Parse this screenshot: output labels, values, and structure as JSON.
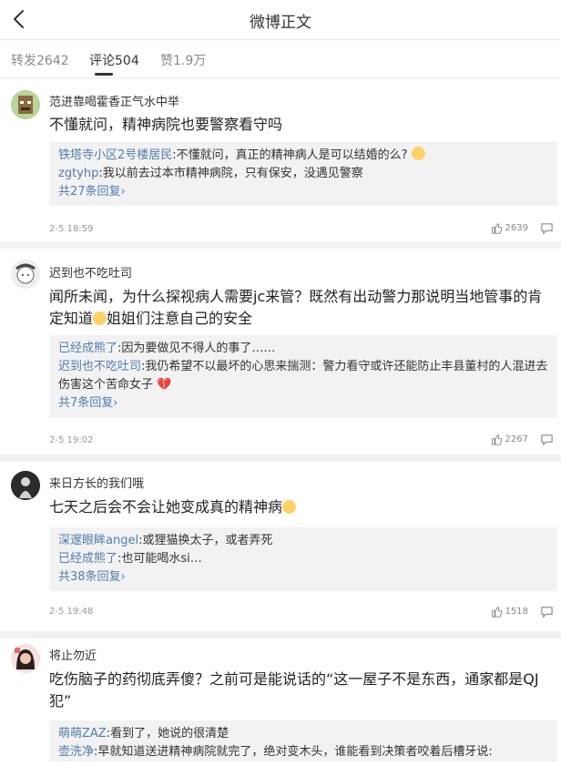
{
  "header": {
    "title": "微博正文"
  },
  "tabs": [
    {
      "label": "转发2642"
    },
    {
      "label": "评论504"
    },
    {
      "label": "赞1.9万"
    }
  ],
  "comments": [
    {
      "user": "范进靠喝霍香正气水中举",
      "text": "不懂就问，精神病院也要警察看守吗",
      "replies": [
        {
          "user": "铁塔寺小区2号楼居民",
          "text": ":不懂就问，真正的精神病人是可以结婚的么?"
        },
        {
          "user": "zgtyhp",
          "text": ":我以前去过本市精神病院，只有保安，没遇见警察"
        }
      ],
      "more": "共27条回复›",
      "time": "2-5 18:59",
      "likes": "2639"
    },
    {
      "user": "迟到也不吃吐司",
      "text_part1": "闻所未闻，为什么探视病人需要jc来管？既然有出动警力那说明当地管事的肯定知道",
      "text_part2": "姐姐们注意自己的安全",
      "replies": [
        {
          "user": "已经成熊了",
          "text": ":因为要做见不得人的事了……"
        },
        {
          "user": "迟到也不吃吐司",
          "text": ":我仍希望不以最坏的心思来揣测：警力看守或许还能防止丰县董村的人混进去伤害这个苦命女子"
        }
      ],
      "more": "共7条回复›",
      "time": "2-5 19:02",
      "likes": "2267"
    },
    {
      "user": "来日方长的我们哦",
      "text": "七天之后会不会让她变成真的精神病",
      "replies": [
        {
          "user": "深邃眼眸angel",
          "text": ":或狸猫换太子，或者弄死"
        },
        {
          "user": "已经成熊了",
          "text": ":也可能喝水si…"
        }
      ],
      "more": "共38条回复›",
      "time": "2-5 19:48",
      "likes": "1518"
    },
    {
      "user": "将止勿近",
      "text": "吃伤脑子的药彻底弄傻？之前可是能说话的“这一屋子不是东西，通家都是QJ犯”",
      "replies": [
        {
          "user": "萌萌ZAZ",
          "text": ":看到了，她说的很清楚"
        },
        {
          "user": "壶洗净",
          "text": ":早就知道送进精神病院就完了，绝对变木头，谁能看到决策者咬着后槽牙说:"
        }
      ]
    }
  ],
  "colors": {
    "link": "#507daf",
    "background_separator": "#f2f2f2",
    "reply_box": "#f2f2f2"
  },
  "icons": [
    "back-arrow-icon",
    "thumbs-up-icon",
    "comment-bubble-icon",
    "emoji-icon",
    "broken-heart-icon"
  ]
}
